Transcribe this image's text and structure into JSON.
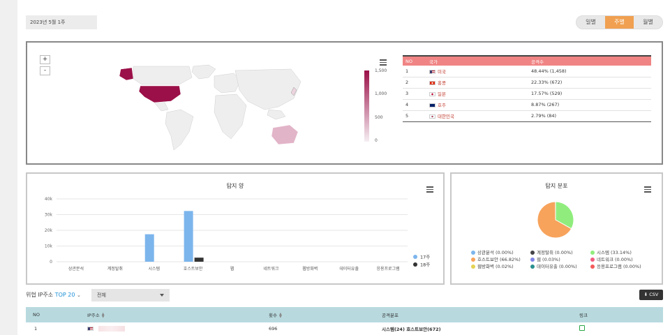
{
  "header": {
    "date": "2023년 5월 1주",
    "tabs": [
      {
        "label": "일별",
        "active": false
      },
      {
        "label": "주별",
        "active": true
      },
      {
        "label": "월별",
        "active": false
      }
    ]
  },
  "map": {
    "zoom_in": "+",
    "zoom_out": "-",
    "legend_ticks": [
      "1,500",
      "1,000",
      "500",
      "0"
    ],
    "table_headers": [
      "NO",
      "국가",
      "공격수"
    ],
    "rows": [
      {
        "no": "1",
        "country": "미국",
        "value": "48.44% (1,458)"
      },
      {
        "no": "2",
        "country": "홍콩",
        "value": "22.33% (672)"
      },
      {
        "no": "3",
        "country": "일본",
        "value": "17.57% (529)"
      },
      {
        "no": "4",
        "country": "호주",
        "value": "8.87% (267)"
      },
      {
        "no": "5",
        "country": "대한민국",
        "value": "2.79% (84)"
      }
    ]
  },
  "chart_data": [
    {
      "type": "bar",
      "title": "탐지 양",
      "categories": [
        "상관분석",
        "계정탈취",
        "시스템",
        "호스트보안",
        "웹",
        "네트워크",
        "웹방화벽",
        "데이터유출",
        "응용프로그램"
      ],
      "series": [
        {
          "name": "17주",
          "color": "#7cb5ec",
          "values": [
            0,
            0,
            17500,
            32300,
            0,
            0,
            0,
            0,
            0
          ]
        },
        {
          "name": "18주",
          "color": "#333333",
          "values": [
            0,
            0,
            0,
            2600,
            0,
            0,
            0,
            0,
            0
          ]
        }
      ],
      "y_ticks": [
        "0",
        "10k",
        "20k",
        "30k",
        "40k"
      ],
      "ylim": [
        0,
        40000
      ]
    },
    {
      "type": "pie",
      "title": "탐지 분포",
      "slices": [
        {
          "label": "상관분석 (0.00%)",
          "value": 0.0,
          "color": "#7cb5ec"
        },
        {
          "label": "계정탈취 (0.00%)",
          "value": 0.0,
          "color": "#434348"
        },
        {
          "label": "시스템 (33.14%)",
          "value": 33.14,
          "color": "#90ed7d"
        },
        {
          "label": "호스트보안 (66.82%)",
          "value": 66.82,
          "color": "#f7a35c"
        },
        {
          "label": "웹 (0.03%)",
          "value": 0.03,
          "color": "#8085e9"
        },
        {
          "label": "네트워크 (0.00%)",
          "value": 0.0,
          "color": "#f15c80"
        },
        {
          "label": "웹방화벽 (0.02%)",
          "value": 0.02,
          "color": "#e4d354"
        },
        {
          "label": "데이터유출 (0.00%)",
          "value": 0.0,
          "color": "#2b908f"
        },
        {
          "label": "응용프로그램 (0.00%)",
          "value": 0.0,
          "color": "#f45b5b"
        }
      ]
    }
  ],
  "filter": {
    "label_prefix": "위협 IP주소",
    "top_label": "TOP",
    "top_value": "20",
    "select_value": "전체",
    "csv_label": "CSV"
  },
  "ip_table": {
    "headers": [
      "NO",
      "IP주소",
      "횟수",
      "공격분포",
      "링크"
    ],
    "rows": [
      {
        "no": "1",
        "count": "696",
        "dist_bold": "시스템(24) 호스트보안(672)"
      }
    ]
  }
}
